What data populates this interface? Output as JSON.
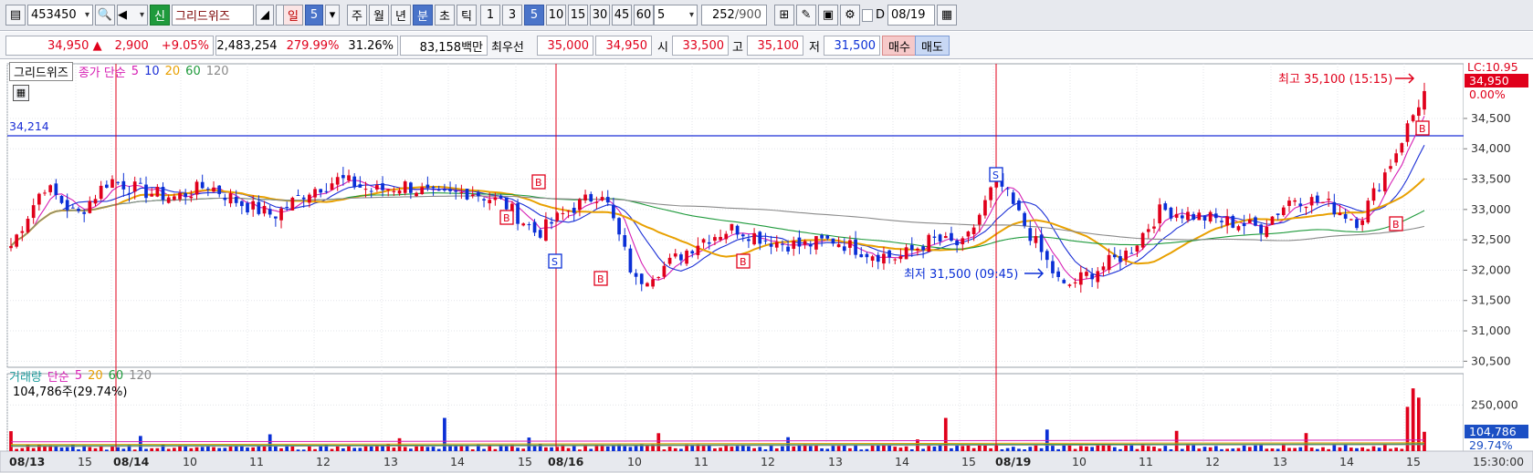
{
  "toolbar": {
    "code": "453450",
    "badge_new": "신",
    "stock_name": "그리드위즈",
    "exclaim": "!",
    "period_day": "일",
    "period_day_count": "5",
    "period_week": "주",
    "period_month": "월",
    "period_year": "년",
    "period_min": "분",
    "period_sec": "초",
    "period_tick": "틱",
    "intervals": [
      "1",
      "3",
      "5",
      "10",
      "15",
      "30",
      "45",
      "60"
    ],
    "interval_input": "5",
    "count_value": "252",
    "count_total": "/900",
    "date_flag": "D",
    "date": "08/19"
  },
  "info": {
    "price": "34,950",
    "change_arrow": "▲",
    "change": "2,900",
    "change_pct": "+9.05%",
    "volume": "2,483,254",
    "vol_ratio": "279.99%",
    "turnover": "31.26%",
    "amount": "83,158백만",
    "best_label": "최우선",
    "best_ask": "35,000",
    "best_bid": "34,950",
    "open_label": "시",
    "open": "33,500",
    "high_label": "고",
    "high": "35,100",
    "low_label": "저",
    "low": "31,500",
    "buy": "매수",
    "sell": "매도"
  },
  "price_legend": {
    "name": "그리드위즈",
    "ma_label": "종가 단순",
    "ma": [
      "5",
      "10",
      "20",
      "60",
      "120"
    ]
  },
  "volume_legend": {
    "name": "거래량",
    "ma_label": "단순",
    "ma": [
      "5",
      "20",
      "60",
      "120"
    ],
    "last_volume": "104,786주(29.74%)"
  },
  "annotations": {
    "hline_value": "34,214",
    "high_note": "최고 35,100 (15:15)",
    "low_note": "최저 31,500 (09:45)",
    "lc_label": "LC:10.95",
    "last_price_tag": "34,950",
    "pct_tag": "0.00%",
    "vol_last_tag": "104,786",
    "vol_pct_tag": "29.74%",
    "time_label": "15:30:00",
    "buy_signal": "B",
    "sell_signal": "S"
  },
  "colors": {
    "up": "#e0001b",
    "down": "#0a2fd6",
    "ma5": "#d61fb4",
    "ma10": "#1b2fd6",
    "ma20": "#e8a000",
    "ma60": "#1f9a3c",
    "ma120": "#8a8a8a"
  },
  "chart_data": {
    "type": "candlestick",
    "y_axis_ticks": [
      "34,500",
      "34,000",
      "33,500",
      "33,000",
      "32,500",
      "32,000",
      "31,500",
      "31,000",
      "30,500"
    ],
    "y_range": [
      30400,
      35400
    ],
    "volume_axis_ticks": [
      "250,000"
    ],
    "x_labels": [
      {
        "label": "08/13",
        "bold": true
      },
      {
        "label": "15",
        "bold": false
      },
      {
        "label": "08/14",
        "bold": true
      },
      {
        "label": "10",
        "bold": false
      },
      {
        "label": "11",
        "bold": false
      },
      {
        "label": "12",
        "bold": false
      },
      {
        "label": "13",
        "bold": false
      },
      {
        "label": "14",
        "bold": false
      },
      {
        "label": "15",
        "bold": false
      },
      {
        "label": "08/16",
        "bold": true
      },
      {
        "label": "10",
        "bold": false
      },
      {
        "label": "11",
        "bold": false
      },
      {
        "label": "12",
        "bold": false
      },
      {
        "label": "13",
        "bold": false
      },
      {
        "label": "14",
        "bold": false
      },
      {
        "label": "15",
        "bold": false
      },
      {
        "label": "08/19",
        "bold": true
      },
      {
        "label": "10",
        "bold": false
      },
      {
        "label": "11",
        "bold": false
      },
      {
        "label": "12",
        "bold": false
      },
      {
        "label": "13",
        "bold": false
      },
      {
        "label": "14",
        "bold": false
      },
      {
        "label": "15",
        "bold": false
      }
    ],
    "price_keypoints": [
      32400,
      33400,
      32900,
      33500,
      33300,
      33200,
      33400,
      33100,
      32900,
      33300,
      33500,
      33300,
      33400,
      33200,
      33300,
      33100,
      32600,
      33000,
      33300,
      31800,
      32100,
      32500,
      32700,
      32500,
      32400,
      32500,
      32300,
      32200,
      32500,
      32400,
      33500,
      32600,
      31700,
      32000,
      32300,
      33000,
      32900,
      32800,
      32700,
      33200,
      33100,
      32800,
      33800,
      34950
    ],
    "horizontal_line": 34214,
    "session_high": 35100,
    "session_low": 31500
  }
}
